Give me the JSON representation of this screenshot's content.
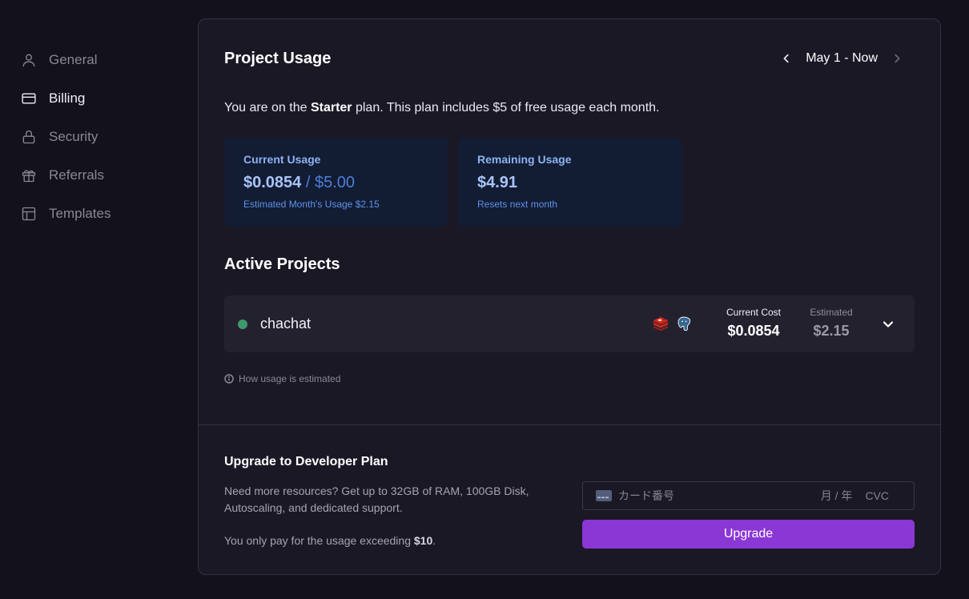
{
  "sidebar": {
    "items": [
      {
        "label": "General",
        "icon": "user-icon",
        "active": false
      },
      {
        "label": "Billing",
        "icon": "credit-card-icon",
        "active": true
      },
      {
        "label": "Security",
        "icon": "lock-icon",
        "active": false
      },
      {
        "label": "Referrals",
        "icon": "gift-icon",
        "active": false
      },
      {
        "label": "Templates",
        "icon": "layout-template-icon",
        "active": false
      }
    ]
  },
  "usage": {
    "title": "Project Usage",
    "date_range": "May 1 - Now",
    "plan_prefix": "You are on the ",
    "plan_name": "Starter",
    "plan_suffix": " plan. This plan includes $5 of free usage each month.",
    "current": {
      "label": "Current Usage",
      "amount": "$0.0854",
      "separator": " / ",
      "limit": "$5.00",
      "sub": "Estimated Month's Usage $2.15"
    },
    "remaining": {
      "label": "Remaining Usage",
      "amount": "$4.91",
      "sub": "Resets next month"
    }
  },
  "projects": {
    "title": "Active Projects",
    "items": [
      {
        "name": "chachat",
        "status_color": "#3c9a6c",
        "services": [
          "redis-icon",
          "postgresql-icon"
        ],
        "current_cost_label": "Current Cost",
        "current_cost": "$0.0854",
        "estimated_label": "Estimated",
        "estimated": "$2.15"
      }
    ],
    "how_link": "How usage is estimated"
  },
  "upgrade": {
    "title": "Upgrade to Developer Plan",
    "description": "Need more resources? Get up to 32GB of RAM, 100GB Disk, Autoscaling, and dedicated support.",
    "pay_prefix": "You only pay for the usage exceeding ",
    "pay_amount": "$10",
    "pay_suffix": ".",
    "card_placeholder": "カード番号",
    "expiry_placeholder": "月 / 年",
    "cvc_placeholder": "CVC",
    "button_label": "Upgrade"
  },
  "colors": {
    "background": "#13111c",
    "card": "#1b1826",
    "accent": "#8a37d6",
    "usage_box": "#121c33",
    "status_green": "#3c9a6c"
  }
}
